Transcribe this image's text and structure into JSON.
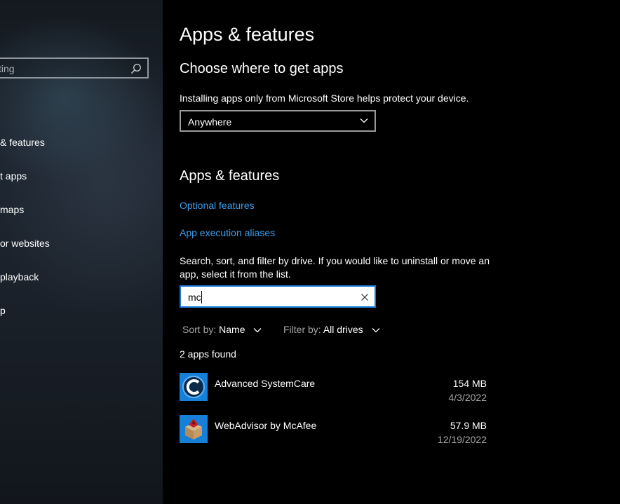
{
  "sidebar": {
    "search_placeholder": "ting",
    "items": [
      {
        "label": "& features"
      },
      {
        "label": "t apps"
      },
      {
        "label": " maps"
      },
      {
        "label": "or websites"
      },
      {
        "label": "playback"
      },
      {
        "label": "p"
      }
    ]
  },
  "main": {
    "page_title": "Apps & features",
    "choose_section": {
      "title": "Choose where to get apps",
      "description": "Installing apps only from Microsoft Store helps protect your device.",
      "dropdown_value": "Anywhere"
    },
    "apps_section": {
      "title": "Apps & features",
      "link_optional": "Optional features",
      "link_aliases": "App execution aliases",
      "instructions": "Search, sort, and filter by drive. If you would like to uninstall or move an app, select it from the list.",
      "search_value": "mc",
      "sort_label": "Sort by:",
      "sort_value": "Name",
      "filter_label": "Filter by:",
      "filter_value": "All drives",
      "count_text": "2 apps found",
      "apps": [
        {
          "name": "Advanced SystemCare",
          "size": "154 MB",
          "date": "4/3/2022",
          "icon": "advanced-systemcare-icon"
        },
        {
          "name": "WebAdvisor by McAfee",
          "size": "57.9 MB",
          "date": "12/19/2022",
          "icon": "webadvisor-icon"
        }
      ]
    }
  },
  "colors": {
    "accent_link": "#3d9dea",
    "focus_border": "#1a7ad6",
    "background": "#000000"
  }
}
